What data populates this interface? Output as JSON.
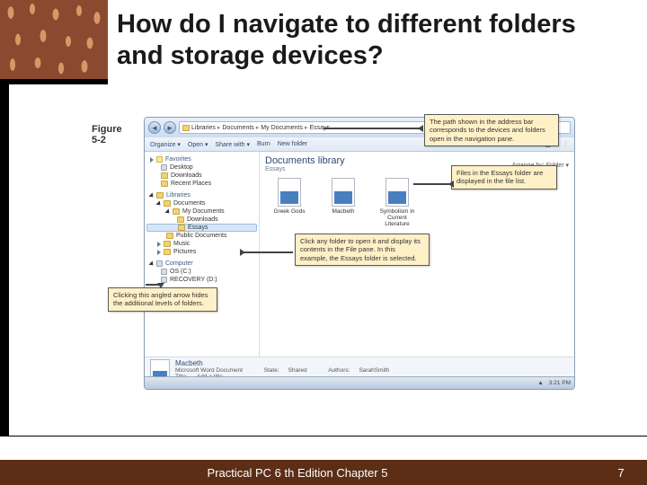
{
  "slide": {
    "title": "How do I navigate to different folders and storage devices?",
    "figure_label_1": "Figure",
    "figure_label_2": "5-2"
  },
  "explorer": {
    "breadcrumb": [
      "Libraries",
      "Documents",
      "My Documents",
      "Essays"
    ],
    "toolbar": {
      "organize": "Organize ▾",
      "open": "Open ▾",
      "share": "Share with ▾",
      "burn": "Burn",
      "new_folder": "New folder"
    },
    "nav": {
      "favorites": "Favorites",
      "fav_items": [
        "Desktop",
        "Downloads",
        "Recent Places"
      ],
      "libraries": "Libraries",
      "lib_documents": "Documents",
      "lib_mydocs": "My Documents",
      "lib_sub": [
        "Downloads",
        "Essays",
        "Public Documents"
      ],
      "lib_music": "Music",
      "lib_pictures": "Pictures",
      "computer": "Computer",
      "comp_items": [
        "OS (C:)",
        "RECOVERY (D:)"
      ]
    },
    "content": {
      "lib_title": "Documents library",
      "lib_sub": "Essays",
      "arrange": "Arrange by:  Folder ▾",
      "files": [
        "Greek Gods",
        "Macbeth",
        "Symbolism in Current Literature"
      ]
    },
    "details": {
      "name": "Macbeth",
      "app": "Microsoft Word Document",
      "state_l": "State:",
      "state_v": "Shared",
      "auth_l": "Authors:",
      "auth_v": "SarahSmith",
      "title_l": "Title:",
      "title_v": "Add a title"
    },
    "taskbar": {
      "time": "3:21 PM"
    }
  },
  "callouts": {
    "c1": "The path shown in the address bar corresponds to the devices and folders open in the navigation pane.",
    "c2": "Files in the Essays folder are displayed in the file list.",
    "c3": "Click any folder to open it and display its contents in the File pane. In this example, the Essays folder is selected.",
    "c4": "Clicking this angled arrow hides the additional levels of folders."
  },
  "footer": {
    "text": "Practical PC 6 th Edition Chapter 5",
    "page": "7"
  }
}
